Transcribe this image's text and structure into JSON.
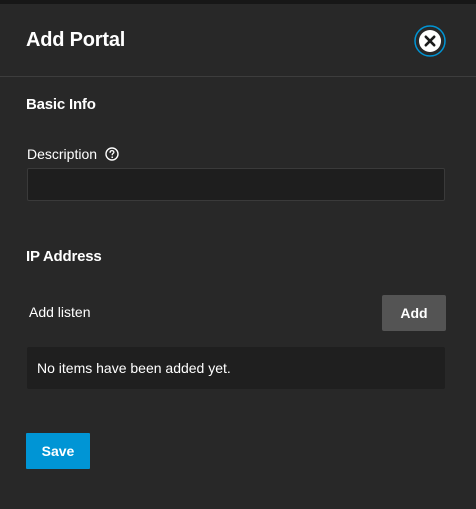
{
  "dialog": {
    "title": "Add Portal",
    "close_icon": "close-circle-icon"
  },
  "basic_info": {
    "section_title": "Basic Info",
    "description_label": "Description",
    "description_value": "",
    "help_icon": "help-circle-icon"
  },
  "ip_address": {
    "section_title": "IP Address",
    "add_listen_label": "Add listen",
    "add_button_label": "Add",
    "empty_message": "No items have been added yet."
  },
  "actions": {
    "save_label": "Save"
  },
  "colors": {
    "background": "#282828",
    "primary": "#0095d5",
    "secondary_button": "#545454",
    "input_background": "#1e1e1e"
  }
}
